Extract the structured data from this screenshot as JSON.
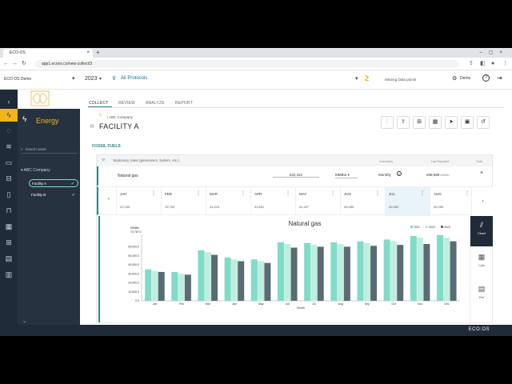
{
  "browser": {
    "tab_title": "ECO-OS",
    "url": "app1.ecoos.co/new-collect/3"
  },
  "header": {
    "brand": "ECO OS Demo",
    "year": "2023",
    "protocols": "All Protocols",
    "missing_count": "2",
    "missing_label": "Missing Data points",
    "user": "Demo"
  },
  "sidebar": {
    "section_title": "Energy",
    "search_placeholder": "Search asset",
    "company": "ABC Company",
    "facilities": [
      {
        "label": "Facility A",
        "selected": true
      },
      {
        "label": "Facility B",
        "selected": false
      }
    ]
  },
  "main": {
    "tabs": [
      "COLLECT",
      "REVIEW",
      "ANALYZE",
      "REPORT"
    ],
    "breadcrumb": "/ ABC Company",
    "facility_title": "FACILITY A",
    "category": "FOSSIL FUELS",
    "card_title": "Stationary Uses (generators, boilers, etc.)",
    "col_granularity": "Granularity",
    "col_last_reported": "Last Reported",
    "col_tools": "Tools",
    "source": {
      "name": "Natural gas",
      "total": "632,341",
      "unit": "MMBtu",
      "granularity": "Monthly",
      "last_reported": "658,688"
    },
    "months": [
      {
        "name": "JAN",
        "value": "22,166"
      },
      {
        "name": "FEB",
        "value": "29,763"
      },
      {
        "name": "MAR",
        "value": "51,224"
      },
      {
        "name": "APR",
        "value": "43,891"
      },
      {
        "name": "MAY",
        "value": "41,407"
      },
      {
        "name": "JUN",
        "value": "59,089"
      },
      {
        "name": "JUL",
        "value": "59,590"
      },
      {
        "name": "AUG",
        "value": "60,289"
      }
    ],
    "side_buttons": [
      "Chart",
      "Calc",
      "Ref"
    ]
  },
  "chart_data": {
    "type": "bar",
    "title": "Natural gas",
    "ylabel": "MMBtu",
    "ylabel_total": "72,787.0",
    "xlabel": "Month",
    "categories": [
      "Jan",
      "Feb",
      "Mar",
      "Apr",
      "May",
      "Jun",
      "Jul",
      "Aug",
      "Sep",
      "Oct",
      "Nov",
      "Dec"
    ],
    "ylim": [
      0,
      72787
    ],
    "yticks": [
      {
        "value": 0,
        "label": "0.0"
      },
      {
        "value": 10000,
        "label": "10,000.0"
      },
      {
        "value": 20000,
        "label": "20,000.0"
      },
      {
        "value": 30000,
        "label": "30,000.0"
      },
      {
        "value": 40000,
        "label": "40,000.0"
      },
      {
        "value": 50000,
        "label": "50,000.0"
      },
      {
        "value": 60000,
        "label": "60,000.0"
      }
    ],
    "series": [
      {
        "name": "2021",
        "color": "#7fdcc8",
        "values": [
          35000,
          32000,
          56000,
          48000,
          46000,
          65000,
          64000,
          65000,
          66000,
          68000,
          72000,
          73000
        ]
      },
      {
        "name": "2022",
        "color": "#bfeee0",
        "values": [
          33000,
          30000,
          54000,
          46000,
          44000,
          63000,
          62000,
          63000,
          64000,
          66000,
          70000,
          70000
        ]
      },
      {
        "name": "2023",
        "color": "#5a6b73",
        "values": [
          32000,
          29000,
          51000,
          44000,
          42000,
          59000,
          60000,
          60000,
          61000,
          62000,
          63000,
          66000
        ]
      }
    ],
    "legend": "top-right",
    "grid": false
  },
  "footer": {
    "logo": "ECO:OS"
  }
}
